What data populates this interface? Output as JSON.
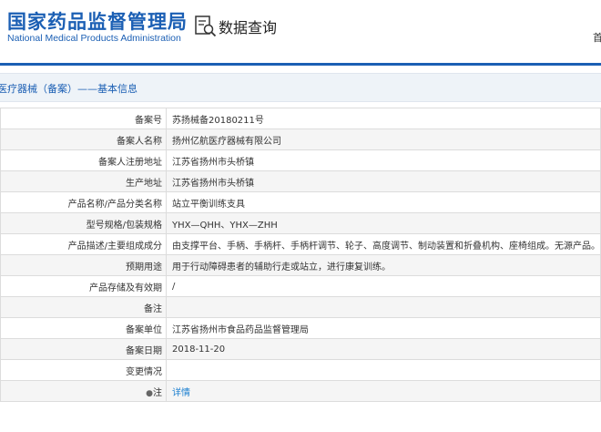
{
  "header": {
    "logo_cn": "国家药品监督管理局",
    "logo_en": "National Medical Products Administration",
    "query_title": "数据查询",
    "corner_text": "首"
  },
  "section": {
    "title": "医疗器械（备案）——基本信息"
  },
  "rows": [
    {
      "label": "备案号",
      "value": "苏扬械备20180211号"
    },
    {
      "label": "备案人名称",
      "value": "扬州亿航医疗器械有限公司"
    },
    {
      "label": "备案人注册地址",
      "value": "江苏省扬州市头桥镇"
    },
    {
      "label": "生产地址",
      "value": "江苏省扬州市头桥镇"
    },
    {
      "label": "产品名称/产品分类名称",
      "value": "站立平衡训练支具"
    },
    {
      "label": "型号规格/包装规格",
      "value": "YHX—QHH、YHX—ZHH"
    },
    {
      "label": "产品描述/主要组成成分",
      "value": "由支撑平台、手柄、手柄杆、手柄杆调节、轮子、高度调节、制动装置和折叠机构、座椅组成。无源产品。"
    },
    {
      "label": "预期用途",
      "value": "用于行动障碍患者的辅助行走或站立，进行康复训练。"
    },
    {
      "label": "产品存储及有效期",
      "value": "/"
    },
    {
      "label": "备注",
      "value": ""
    },
    {
      "label": "备案单位",
      "value": "江苏省扬州市食品药品监督管理局"
    },
    {
      "label": "备案日期",
      "value": "2018-11-20"
    },
    {
      "label": "变更情况",
      "value": ""
    },
    {
      "label": "注",
      "value": "详情"
    }
  ],
  "colors": {
    "brand": "#1b5fb4",
    "link": "#1b7fd0"
  }
}
